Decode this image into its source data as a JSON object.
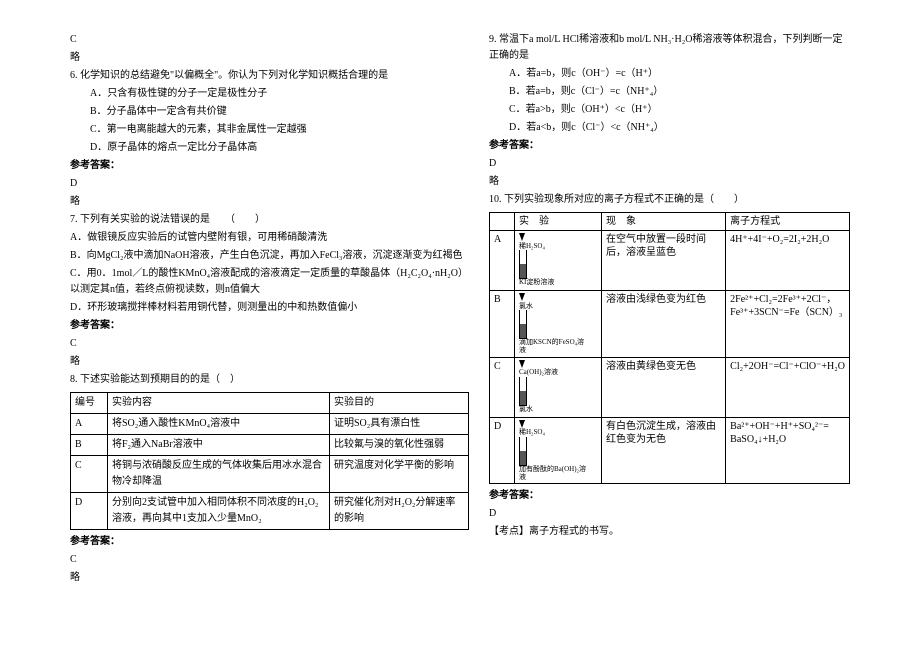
{
  "left": {
    "l0": "C",
    "l1": "略",
    "q6": {
      "stem": "6. 化学知识的总结避免\"以偏概全\"。你认为下列对化学知识概括合理的是",
      "a": "A．只含有极性键的分子一定是极性分子",
      "b": "B．分子晶体中一定含有共价键",
      "c": "C．第一电离能越大的元素，其非金属性一定越强",
      "d": "D．原子晶体的熔点一定比分子晶体高",
      "ak": "参考答案：",
      "ans": "D",
      "om": "略"
    },
    "q7": {
      "stem": "7. 下列有关实验的说法错误的是　　（　　）",
      "a": "A．做银镜反应实验后的试管内壁附有银，可用稀硝酸清洗",
      "b": "B．向MgCl₂液中滴加NaOH溶液，产生白色沉淀，再加入FeCl₃溶液，沉淀逐渐变为红褐色",
      "c": "C．用0．1mol／L的酸性KMnO₄溶液配成的溶液滴定一定质量的草酸晶体（H₂C₂O₄·nH₂O）以测定其n值，若终点俯视读数，则n值偏大",
      "d": "D．环形玻璃搅拌棒材料若用铜代替，则测量出的中和热数值偏小",
      "ak": "参考答案：",
      "ans": "C",
      "om": "略"
    },
    "q8": {
      "stem": "8. 下述实验能达到预期目的的是（　）",
      "th1": "编号",
      "th2": "实验内容",
      "th3": "实验目的",
      "rA1": "A",
      "rA2": "将SO₂通入酸性KMnO₄溶液中",
      "rA3": "证明SO₂具有漂白性",
      "rB1": "B",
      "rB2": "将F₂通入NaBr溶液中",
      "rB3": "比较氟与溴的氧化性强弱",
      "rC1": "C",
      "rC2": "将铜与浓硝酸反应生成的气体收集后用冰水混合物冷却降温",
      "rC3": "研究温度对化学平衡的影响",
      "rD1": "D",
      "rD2": "分别向2支试管中加入相同体积不同浓度的H₂O₂溶液，再向其中1支加入少量MnO₂",
      "rD3": "研究催化剂对H₂O₂分解速率的影响",
      "ak": "参考答案：",
      "ans": "C",
      "om": "略"
    }
  },
  "right": {
    "q9": {
      "stem": "9. 常温下a mol/L HCl稀溶液和b mol/L NH₃·H₂O稀溶液等体积混合，下列判断一定正确的是",
      "a": "A．若a=b，则c（OH⁻）=c（H⁺）",
      "b": "B．若a=b，则c（Cl⁻）=c（NH⁺₄）",
      "c": "C．若a>b，则c（OH⁺）<c（H⁺）",
      "d": "D．若a<b，则c（Cl⁻）<c（NH⁺₄）",
      "ak": "参考答案：",
      "ans": "D",
      "om": "略"
    },
    "q10": {
      "stem": "10. 下列实验现象所对应的离子方程式不正确的是（　　）",
      "th1": "",
      "th2": "实　验",
      "th3": "现　象",
      "th4": "离子方程式",
      "rA1": "A",
      "rA2a": "稀H₂SO₄",
      "rA2b": "KI淀粉溶液",
      "rA3": "在空气中放置一段时间后，溶液呈蓝色",
      "rA4": "4H⁺+4I⁻+O₂=2I₂+2H₂O",
      "rB1": "B",
      "rB2a": "氯水",
      "rB2b": "滴加KSCN的FeSO₄溶液",
      "rB3": "溶液由浅绿色变为红色",
      "rB4": "2Fe²⁺+Cl₂=2Fe³⁺+2Cl⁻，Fe³⁺+3SCN⁻=Fe（SCN）₃",
      "rC1": "C",
      "rC2a": "Ca(OH)₂溶液",
      "rC2b": "氯水",
      "rC3": "溶液由黄绿色变无色",
      "rC4": "Cl₂+2OH⁻=Cl⁻+ClO⁻+H₂O",
      "rD1": "D",
      "rD2a": "稀H₂SO₄",
      "rD2b": "加有酚酞的Ba(OH)₂溶液",
      "rD3": "有白色沉淀生成，溶液由红色变为无色",
      "rD4": "Ba²⁺+OH⁻+H⁺+SO₄²⁻= BaSO₄↓+H₂O",
      "ak": "参考答案：",
      "ans": "D",
      "note": "【考点】离子方程式的书写。"
    }
  }
}
